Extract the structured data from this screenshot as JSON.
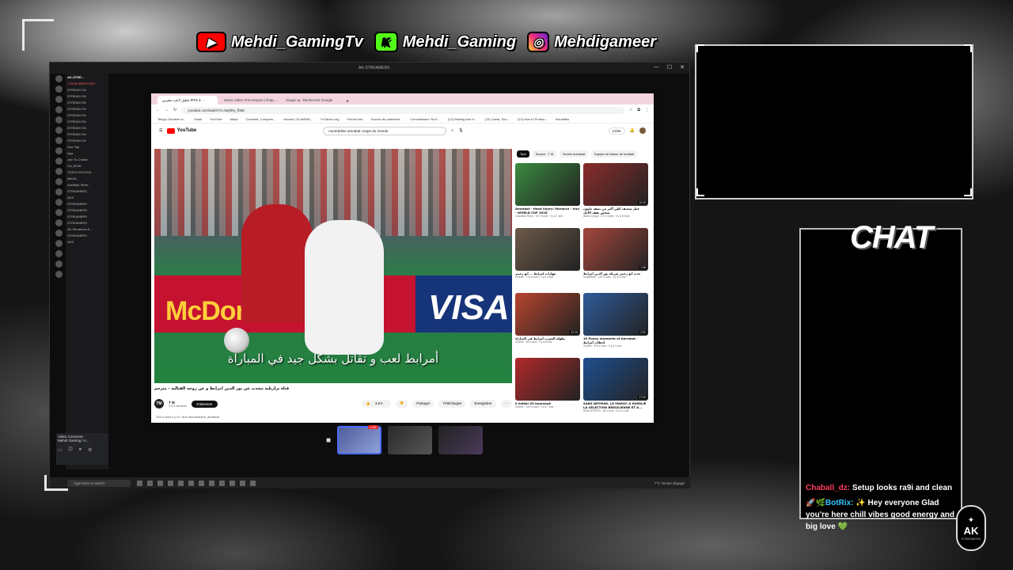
{
  "social": {
    "youtube": "Mehdi_GamingTv",
    "kick": "Mehdi_Gaming",
    "instagram": "Mehdigameer"
  },
  "desktop": {
    "window_title": "AK-STREAMERS",
    "discord_server": "AK-STRE...",
    "channels": [
      "1 NEW MENTIONS",
      "STREAM ON",
      "STREAM ON",
      "STREAM ON",
      "STREAM ON",
      "STREAM ON",
      "STREAM ON",
      "STREAM ON",
      "STREAM ON",
      "STREAM ON",
      "One Tap",
      "logs",
      "Join To Create",
      "LM_BGIN",
      "TOKCH ROJOOL",
      "Mehdi...",
      "AnkiNick Stree...",
      "STREAMERS",
      "AKS",
      "STREAMERS",
      "STREAMERS",
      "STREAMERS",
      "STREAMERS",
      "AK Streamers E...",
      "STREAMERS",
      "AKS"
    ],
    "voice_connected": "Video Connecte",
    "voice_sub": "Mehdi Gaming / A...",
    "taskbar_search": "Type here to search",
    "taskbar_weather": "7°C Temps dégagé"
  },
  "browser": {
    "tabs": [
      "تحليل لاعب مغربي RTX 4 …",
      "Music Video Free Export | Grap…",
      "Soupe aj - Recherche Google"
    ],
    "url": "youtube.com/watch?v=5ej0Ry_fbtM",
    "bookmarks": [
      "Telugu Goodern w...",
      "Gmail",
      "YouTube",
      "Maps",
      "Convertir, Compres...",
      "Accueil | DI AMINE...",
      "FuTacion.org",
      "French info",
      "Succès de paiement...",
      "Convertisseur YouT...",
      "(12) Making Afro H...",
      "(13) Canal, Sou...",
      "(12) How to Produc...",
      "Actualités"
    ],
    "youtube_logo": "YouTube",
    "search_query": "noureddine amrabat coupe du monde",
    "create_label": "Créer",
    "video": {
      "subtitle": "أمرابط لعب و تقاتل بشكل جيد في المباراة",
      "title": "قناة برازيلية تتحدث عن نور الدين امرابط و عن روحه القتالية - مترجم",
      "channel": "T M",
      "subscribers": "3 974 abonnés",
      "subscribe": "S'abonner",
      "likes": "3,9 k",
      "share": "Partager",
      "download": "Télécharger",
      "save": "Enregistrer",
      "stats": "326 k vues  il y a 7 ans  #noureddine_amrabat",
      "channel_avatar": "TM"
    },
    "chips": [
      "Tout",
      "Source : T M",
      "Noréin Amrabat",
      "Equipe du Maroc de football"
    ],
    "recommendations": [
      {
        "title": "Amrabat - Head Injury: Morocco - Iran - WORLD CUP 2018",
        "meta": "Leonardo Rock · 157 k vues · il y a 7 ans",
        "duration": "",
        "color": "#3a8a3f"
      },
      {
        "title": "عمل سخيف أظن أكثر من نصف مليون شخص يفقد الأمل",
        "meta": "Issam Chrqui · 274 k vues · il y a 6 mois",
        "duration": "12:12",
        "color": "#8a2c2c"
      },
      {
        "title": "مهارات امرابط ... أبو زعيتر",
        "meta": "Chaîne · 174 k vues · il y a 4 ans",
        "duration": "",
        "color": "#6d5a4a"
      },
      {
        "title": "عذب أبو زعيتر شريكة نور الدين أمرابط",
        "meta": "SocialRete · 167 k vues · il y a 4 ans",
        "duration": "1:36",
        "color": "#a5473d"
      },
      {
        "title": "بطولة المغرب أمرابط في المباراة",
        "meta": "Chaîne · 46 k vues · il y a 6 ans",
        "duration": "12:13",
        "color": "#b8452f"
      },
      {
        "title": "10 Funny moments of Amrabat - لحظات أمرابط",
        "meta": "Chaîne · 878 k vues · il y a 4 ans",
        "duration": "2:31",
        "color": "#2f5b9a"
      },
      {
        "title": "il mékki VS bourzouk",
        "meta": "Chaîne · 122 k vues · il y a 7 ans",
        "duration": "",
        "color": "#b12a2a"
      },
      {
        "title": "SANS NEYMAR, LE MAROC A HUMILIÉ LA SÉLECTION BRÉSILIENNE ET A...",
        "meta": "RAM SPORTS · 96 k vues · il y a 2 ans",
        "duration": "17:20",
        "color": "#1f4f8f"
      }
    ]
  },
  "strip": {
    "live_label": "LIVE"
  },
  "chat": {
    "title": "CHAT",
    "messages": [
      {
        "user": "Chaball_dz:",
        "text": "Setup looks ra9i and clean"
      },
      {
        "user": "BotRix:",
        "text": "✨ Hey everyone Glad you're here chill vibes good energy and big love 💚"
      }
    ],
    "bot_badge": "🚀🌿",
    "logo": "AK",
    "logo_sub": "STREAMERS"
  },
  "colors": {
    "accent_red": "#ff0000",
    "kick_green": "#53fc18",
    "chat_user1": "#ff3b5c",
    "chat_user2": "#39c7ff"
  }
}
